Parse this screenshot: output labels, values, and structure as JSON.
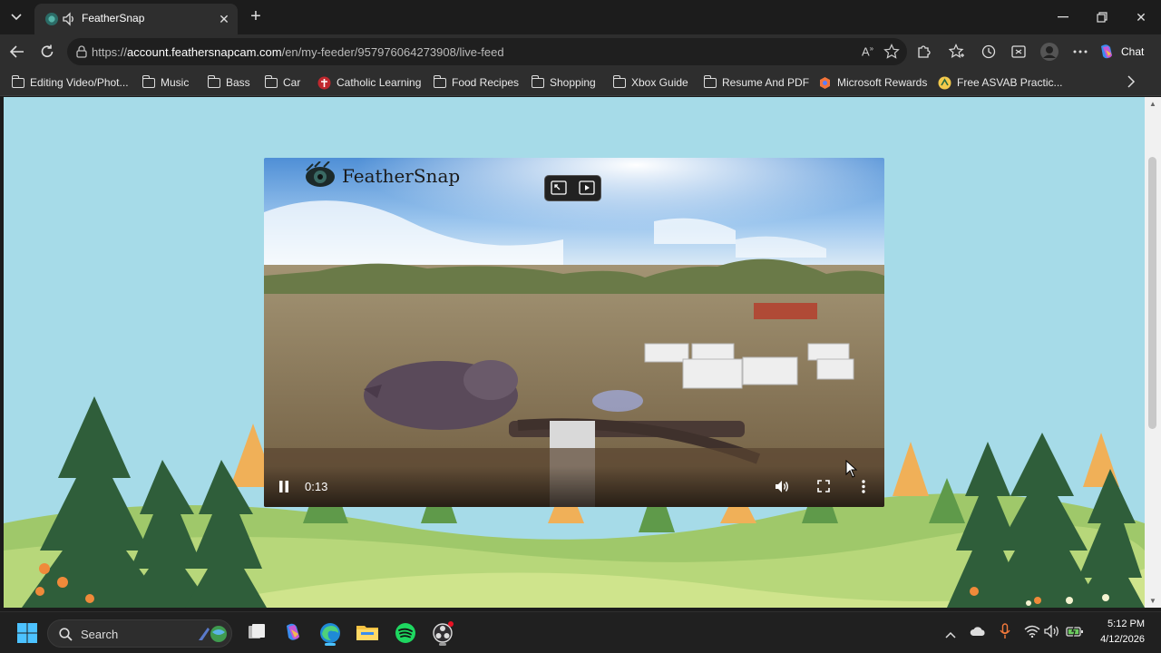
{
  "browser": {
    "tab": {
      "title": "FeatherSnap"
    },
    "url": {
      "prefix": "https://",
      "host": "account.feathersnapcam.com",
      "path": "/en/my-feeder/957976064273908/live-feed"
    },
    "chat_label": "Chat",
    "reader_glyph": "A",
    "bookmarks": [
      {
        "label": "Editing Video/Phot...",
        "icon": "folder-icon"
      },
      {
        "label": "Music",
        "icon": "folder-icon"
      },
      {
        "label": "Bass",
        "icon": "folder-icon"
      },
      {
        "label": "Car",
        "icon": "folder-icon"
      },
      {
        "label": "Catholic Learning",
        "icon": "site-icon"
      },
      {
        "label": "Food Recipes",
        "icon": "folder-icon"
      },
      {
        "label": "Shopping",
        "icon": "folder-icon"
      },
      {
        "label": "Xbox Guide",
        "icon": "folder-icon"
      },
      {
        "label": "Resume And PDF",
        "icon": "folder-icon"
      },
      {
        "label": "Microsoft Rewards",
        "icon": "rewards-icon"
      },
      {
        "label": "Free ASVAB Practic...",
        "icon": "asvab-icon"
      }
    ]
  },
  "page": {
    "background_color": "#a6dbe8",
    "video": {
      "logo_text": "FeatherSnap",
      "time": "0:13",
      "playing": true
    }
  },
  "taskbar": {
    "search_placeholder": "Search",
    "clock_time": "5:12 PM",
    "clock_date": "4/12/2026"
  }
}
